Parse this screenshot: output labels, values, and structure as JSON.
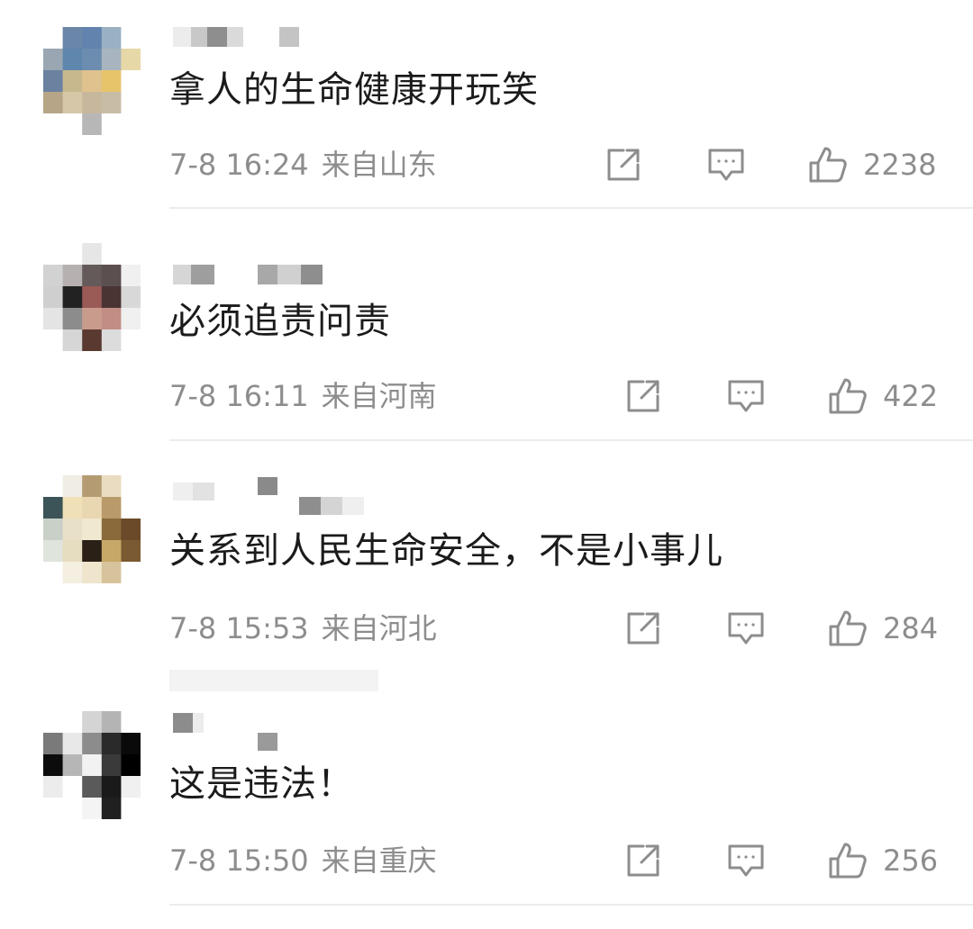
{
  "comments": [
    {
      "text": "拿人的生命健康开玩笑",
      "time": "7-8 16:24",
      "location": "来自山东",
      "likes": "2238",
      "avatar_tiles": [
        [
          "#ffffff",
          "#6a86a8",
          "#6183ad",
          "#9ab1c4",
          "#ffffff"
        ],
        [
          "#9aa7b3",
          "#5f86ad",
          "#6c8db0",
          "#a8b4bf",
          "#e7d8a8"
        ],
        [
          "#6a82a0",
          "#c8b88e",
          "#dfc28e",
          "#e7c46a",
          "#ffffff"
        ],
        [
          "#b7a587",
          "#d7c7a9",
          "#c7b79d",
          "#c9bca5",
          "#ffffff"
        ],
        [
          "#ffffff",
          "#ffffff",
          "#b7b7b7",
          "#ffffff",
          "#ffffff"
        ]
      ]
    },
    {
      "text": "必须追责问责",
      "time": "7-8 16:11",
      "location": "来自河南",
      "likes": "422",
      "avatar_tiles": [
        [
          "#ffffff",
          "#ffffff",
          "#e6e6e6",
          "#ffffff",
          "#ffffff"
        ],
        [
          "#d2d2d2",
          "#b7b0b0",
          "#645a5a",
          "#5c4f50",
          "#f0f0f0"
        ],
        [
          "#cfcfcf",
          "#222222",
          "#9a5a55",
          "#4a3433",
          "#d8d8d8"
        ],
        [
          "#e4e4e4",
          "#8c8c8c",
          "#c99b8d",
          "#c28d85",
          "#f0f0f0"
        ],
        [
          "#ffffff",
          "#d6d6d6",
          "#5a3a30",
          "#dcdcdc",
          "#ffffff"
        ]
      ]
    },
    {
      "text": "关系到人民生命安全，不是小事儿",
      "time": "7-8 15:53",
      "location": "来自河北",
      "likes": "284",
      "avatar_tiles": [
        [
          "#ffffff",
          "#f0ede4",
          "#b59b72",
          "#e9dcc0",
          "#ffffff"
        ],
        [
          "#3c5458",
          "#efe0b8",
          "#e9d7b1",
          "#b99a6a",
          "#ffffff"
        ],
        [
          "#c8d0c8",
          "#e9e0c8",
          "#f1e8d0",
          "#8a6a3a",
          "#6a4a28"
        ],
        [
          "#dfe4dc",
          "#e6dcc0",
          "#2a2016",
          "#c8a868",
          "#7a5a32"
        ],
        [
          "#ffffff",
          "#f4efe0",
          "#efe4cc",
          "#d6c39c",
          "#ffffff"
        ]
      ]
    },
    {
      "text": "这是违法！",
      "time": "7-8 15:50",
      "location": "来自重庆",
      "likes": "256",
      "avatar_tiles": [
        [
          "#ffffff",
          "#ffffff",
          "#d4d4d4",
          "#b4b4b4",
          "#ffffff"
        ],
        [
          "#7a7a7a",
          "#e8e8e8",
          "#8c8c8c",
          "#2a2a2a",
          "#0a0a0a"
        ],
        [
          "#0c0c0c",
          "#b6b6b6",
          "#f2f2f2",
          "#3a3a3a",
          "#000000"
        ],
        [
          "#ececec",
          "#ffffff",
          "#5a5a5a",
          "#1a1a1a",
          "#f0f0f0"
        ],
        [
          "#ffffff",
          "#ffffff",
          "#f4f4f4",
          "#202020",
          "#ffffff"
        ]
      ]
    }
  ],
  "icons": {
    "share": "share-icon",
    "comment": "comment-icon",
    "like": "like-icon"
  },
  "colors": {
    "text": "#1b1b1b",
    "meta": "#8d8d8d",
    "divider": "#ececec"
  }
}
